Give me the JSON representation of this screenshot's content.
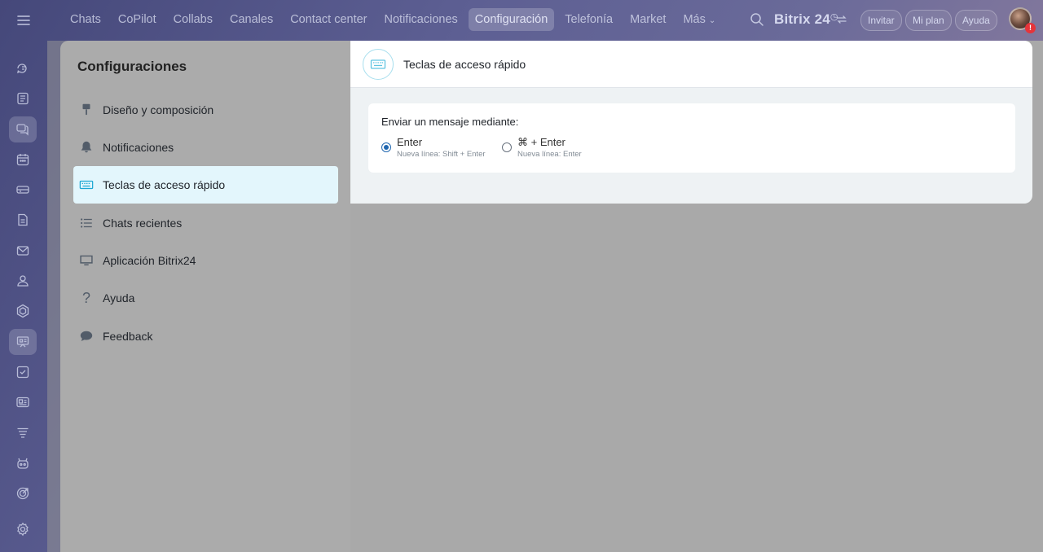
{
  "topbar": {
    "nav": [
      "Chats",
      "CoPilot",
      "Collabs",
      "Canales",
      "Contact center",
      "Notificaciones",
      "Configuración",
      "Telefonía",
      "Market",
      "Más"
    ],
    "active_nav": "Configuración",
    "brand": "Bitrix 24",
    "invite": "Invitar",
    "plan": "Mi plan",
    "help": "Ayuda",
    "avatar_badge": "!"
  },
  "rail": {
    "icons": [
      "chat-bubbles-icon",
      "feed-icon",
      "messenger-icon",
      "calendar-icon",
      "drive-icon",
      "document-icon",
      "mail-icon",
      "team-icon",
      "hexagon-icon",
      "board-icon",
      "tasks-icon",
      "crm-card-icon",
      "filter-icon",
      "robot-icon",
      "target-icon",
      "settings-icon"
    ],
    "active_index": 2
  },
  "settings": {
    "title": "Configuraciones",
    "items": [
      {
        "label": "Diseño y composición",
        "icon": "brush-icon"
      },
      {
        "label": "Notificaciones",
        "icon": "bell-icon"
      },
      {
        "label": "Teclas de acceso rápido",
        "icon": "keyboard-icon"
      },
      {
        "label": "Chats recientes",
        "icon": "list-icon"
      },
      {
        "label": "Aplicación Bitrix24",
        "icon": "monitor-icon"
      },
      {
        "label": "Ayuda",
        "icon": "question-icon"
      },
      {
        "label": "Feedback",
        "icon": "speech-bubble-icon"
      }
    ],
    "active_item": "Teclas de acceso rápido"
  },
  "panel": {
    "title": "Teclas de acceso rápido",
    "send_heading": "Enviar un mensaje mediante:",
    "options": [
      {
        "label": "Enter",
        "sub": "Nueva línea: Shift + Enter",
        "checked": true
      },
      {
        "label": "⌘ + Enter",
        "sub": "Nueva línea: Enter",
        "checked": false
      }
    ]
  },
  "colors": {
    "accent": "#2067b0",
    "active_menu_bg": "#e3f6fc",
    "badge": "#e6343a"
  }
}
